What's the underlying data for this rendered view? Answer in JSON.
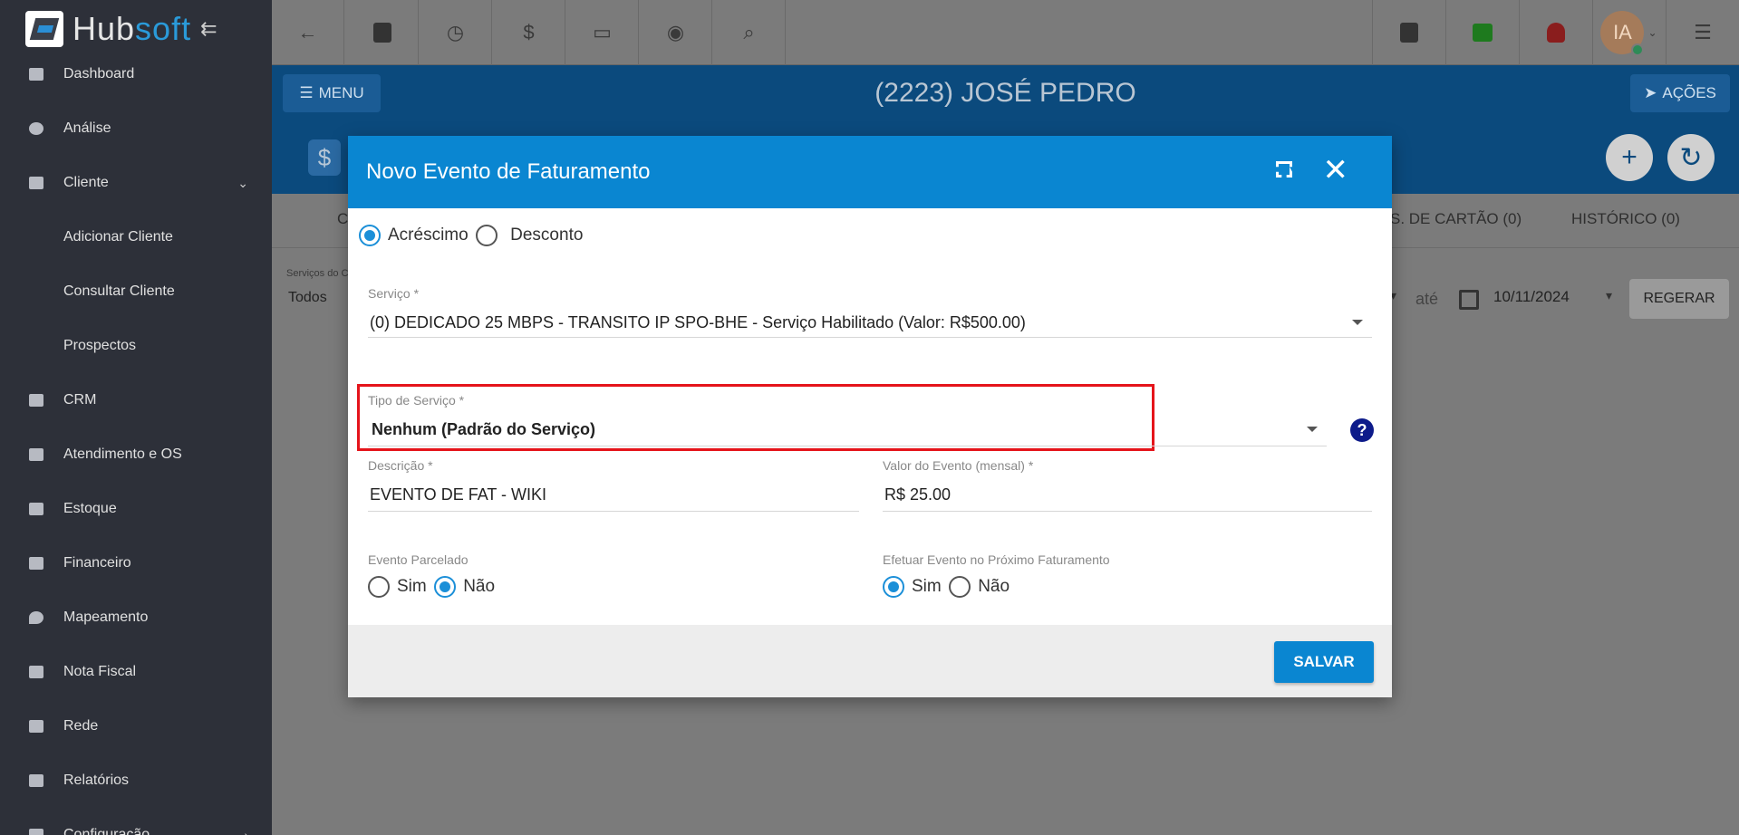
{
  "app": {
    "logo_hub": "Hub",
    "logo_soft": "soft"
  },
  "sidebar": {
    "items": [
      {
        "label": "Dashboard"
      },
      {
        "label": "Análise"
      },
      {
        "label": "Cliente"
      },
      {
        "label": "Adicionar Cliente"
      },
      {
        "label": "Consultar Cliente"
      },
      {
        "label": "Prospectos"
      },
      {
        "label": "CRM"
      },
      {
        "label": "Atendimento e OS"
      },
      {
        "label": "Estoque"
      },
      {
        "label": "Financeiro"
      },
      {
        "label": "Mapeamento"
      },
      {
        "label": "Nota Fiscal"
      },
      {
        "label": "Rede"
      },
      {
        "label": "Relatórios"
      },
      {
        "label": "Configuração"
      }
    ]
  },
  "topbar": {
    "avatar_initials": "IA"
  },
  "header": {
    "menu_label": "MENU",
    "title": "(2223) JOSÉ PEDRO",
    "acoes_label": "AÇÕES"
  },
  "tabs": {
    "first_partial": "C",
    "cartao": "S. DE CARTÃO (0)",
    "historico": "HISTÓRICO (0)"
  },
  "filters": {
    "label": "Serviços do C",
    "value": "Todos",
    "ate": "até",
    "date": "10/11/2024",
    "regerar": "REGERAR"
  },
  "modal": {
    "title": "Novo Evento de Faturamento",
    "tipo_evento": {
      "options": [
        "Acréscimo",
        "Desconto"
      ],
      "selected": "Acréscimo"
    },
    "servico": {
      "label": "Serviço",
      "value": "(0) DEDICADO 25 MBPS - TRANSITO IP SPO-BHE - Serviço Habilitado (Valor: R$500.00)"
    },
    "tipo_servico": {
      "label": "Tipo de Serviço",
      "value": "Nenhum (Padrão do Serviço)"
    },
    "descricao": {
      "label": "Descrição",
      "value": "EVENTO DE FAT - WIKI"
    },
    "valor": {
      "label": "Valor do Evento (mensal)",
      "value": "R$ 25.00"
    },
    "parcelado": {
      "label": "Evento Parcelado",
      "options": [
        "Sim",
        "Não"
      ],
      "selected": "Não"
    },
    "proximo": {
      "label": "Efetuar Evento no Próximo Faturamento",
      "options": [
        "Sim",
        "Não"
      ],
      "selected": "Sim"
    },
    "salvar_label": "SALVAR",
    "required_mark": "*",
    "help_glyph": "?"
  },
  "colors": {
    "modal_header": "#0a86d1",
    "highlight": "#e5141b",
    "sidebar": "#2d3039"
  }
}
